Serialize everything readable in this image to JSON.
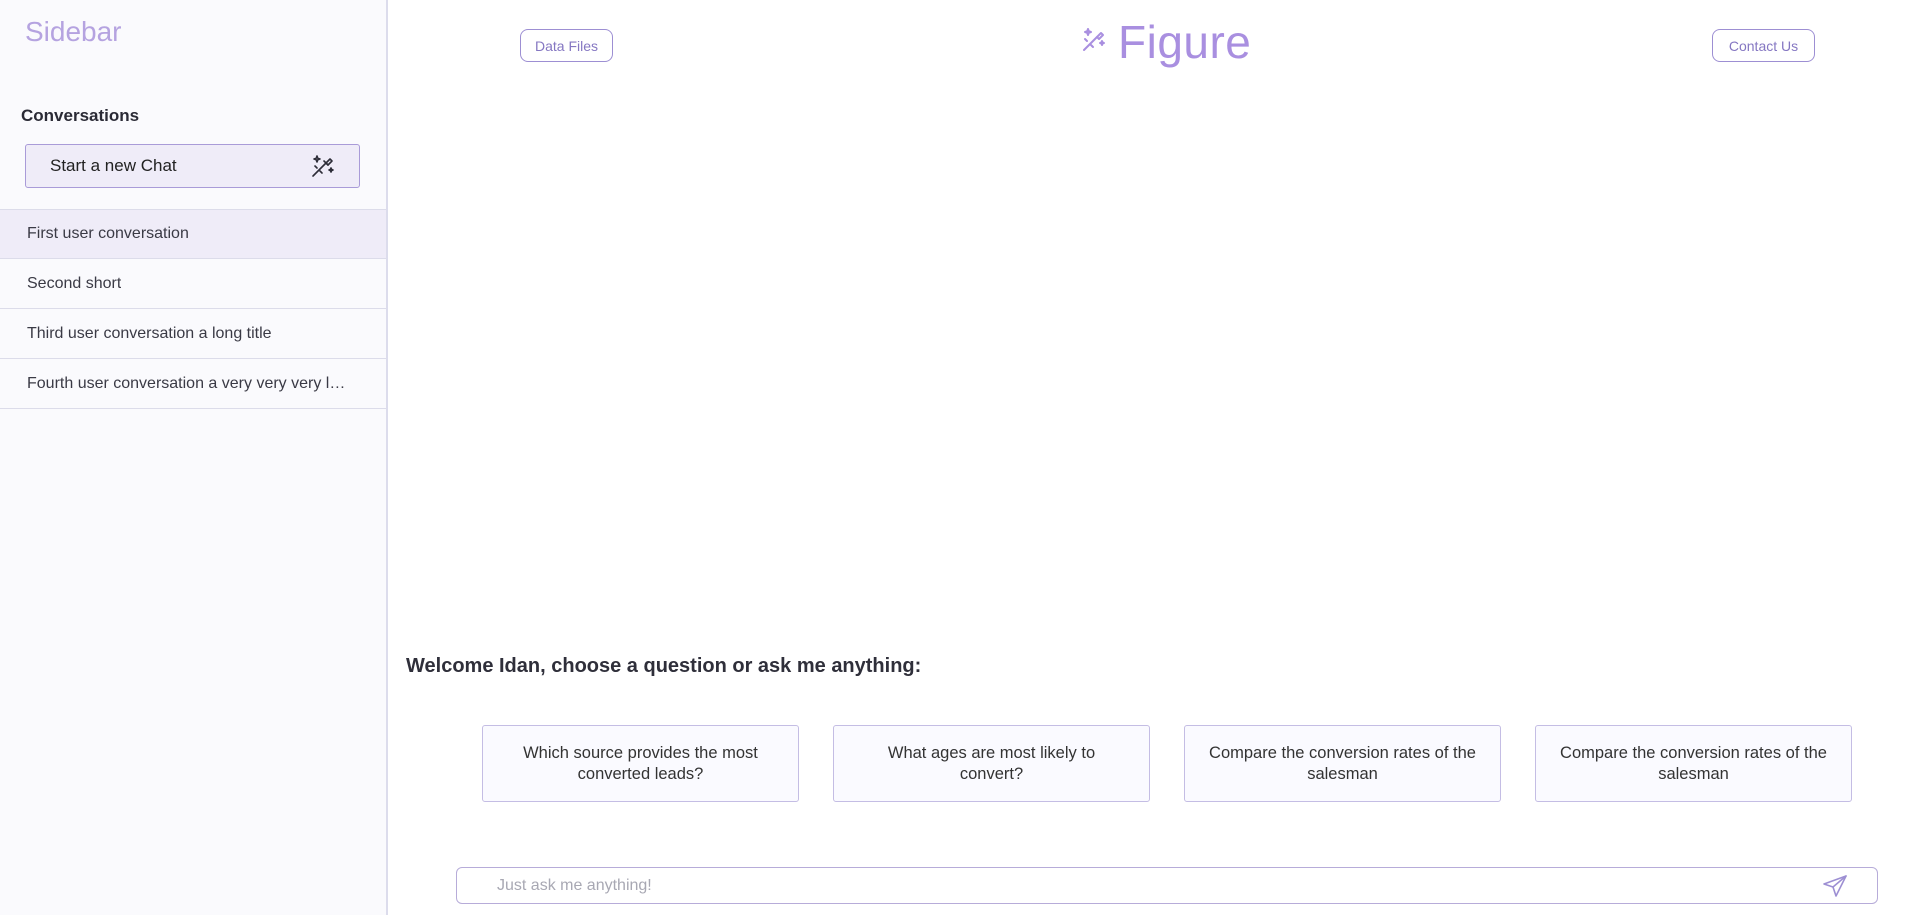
{
  "sidebar": {
    "title": "Sidebar",
    "conversations_heading": "Conversations",
    "new_chat_label": "Start a new Chat",
    "items": [
      {
        "label": "First user conversation"
      },
      {
        "label": "Second short"
      },
      {
        "label": "Third user conversation a long title"
      },
      {
        "label": "Fourth user conversation a very very very long title"
      }
    ]
  },
  "header": {
    "data_files_label": "Data Files",
    "logo_text": "Figure",
    "contact_label": "Contact Us"
  },
  "main": {
    "welcome_text": "Welcome Idan, choose a question or ask me anything:",
    "suggestions": [
      {
        "label": "Which source provides the most converted leads?"
      },
      {
        "label": "What ages are most likely to convert?"
      },
      {
        "label": "Compare the conversion rates of the salesman"
      },
      {
        "label": "Compare the conversion rates of the salesman"
      }
    ],
    "input_placeholder": "Just ask me anything!"
  },
  "icons": {
    "logo": "magic-wand-icon",
    "new_chat": "magic-wand-icon",
    "send": "send-icon"
  },
  "colors": {
    "accent": "#a98fe0",
    "accent_border": "#9d8fd3",
    "sidebar_bg": "#fafafd",
    "active_item_bg": "#efecf8"
  }
}
